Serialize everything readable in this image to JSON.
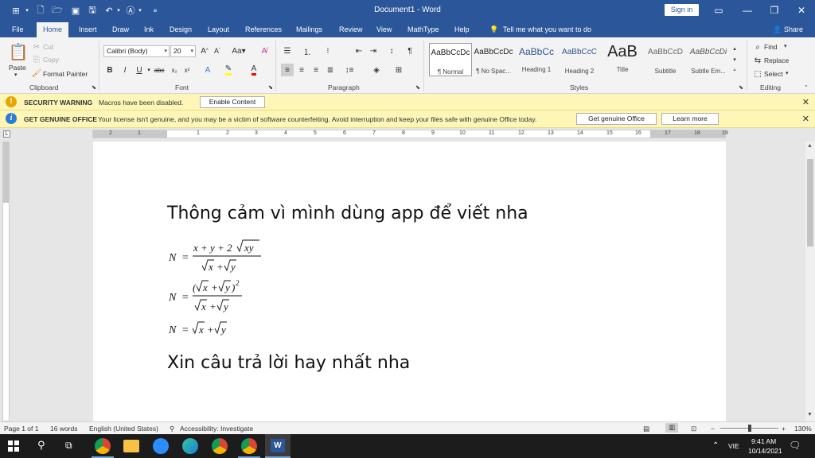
{
  "titlebar": {
    "doc_title": "Document1 - Word",
    "signin": "Sign in",
    "qat_icons": [
      "word-logo-icon",
      "new-doc-icon",
      "open-icon",
      "form-icon",
      "save-icon",
      "undo-icon",
      "ink-icon",
      "customize-icon"
    ]
  },
  "tabs": [
    "File",
    "Home",
    "Insert",
    "Draw",
    "Ink",
    "Design",
    "Layout",
    "References",
    "Mailings",
    "Review",
    "View",
    "MathType",
    "Help"
  ],
  "tell_me": "Tell me what you want to do",
  "share": "Share",
  "ribbon": {
    "clipboard": {
      "paste": "Paste",
      "cut": "Cut",
      "copy": "Copy",
      "format_painter": "Format Painter",
      "label": "Clipboard"
    },
    "font": {
      "name": "Calibri (Body)",
      "size": "20",
      "label": "Font"
    },
    "paragraph": {
      "label": "Paragraph"
    },
    "styles": {
      "label": "Styles",
      "items": [
        {
          "preview": "AaBbCcDc",
          "name": "¶ Normal"
        },
        {
          "preview": "AaBbCcDc",
          "name": "¶ No Spac..."
        },
        {
          "preview": "AaBbCc",
          "name": "Heading 1"
        },
        {
          "preview": "AaBbCcC",
          "name": "Heading 2"
        },
        {
          "preview": "AaB",
          "name": "Title"
        },
        {
          "preview": "AaBbCcD",
          "name": "Subtitle"
        },
        {
          "preview": "AaBbCcDi",
          "name": "Subtle Em..."
        }
      ]
    },
    "editing": {
      "find": "Find",
      "replace": "Replace",
      "select": "Select",
      "label": "Editing"
    }
  },
  "security_bar": {
    "head": "SECURITY WARNING",
    "message": "Macros have been disabled.",
    "button": "Enable Content"
  },
  "genuine_bar": {
    "head": "GET GENUINE OFFICE",
    "message": "Your license isn't genuine, and you may be a victim of software counterfeiting. Avoid interruption and keep your files safe with genuine Office today.",
    "button1": "Get genuine Office",
    "button2": "Learn more"
  },
  "ruler_numbers": [
    "2",
    "1",
    "1",
    "2",
    "3",
    "4",
    "5",
    "6",
    "7",
    "8",
    "9",
    "10",
    "11",
    "12",
    "13",
    "14",
    "15",
    "16",
    "17",
    "18",
    "19"
  ],
  "document": {
    "line1": "Thông cảm vì mình dùng app để viết nha",
    "line2": "Xin câu trả lời hay nhất nha",
    "equations": [
      {
        "lhs": "N =",
        "numerator": "x + y + 2√xy",
        "denominator": "√x + √y"
      },
      {
        "lhs": "N =",
        "numerator": "(√x + √y)²",
        "denominator": "√x + √y"
      },
      {
        "lhs": "N =",
        "expr": "√x + √y"
      }
    ]
  },
  "status": {
    "page": "Page 1 of 1",
    "words": "16 words",
    "language": "English (United States)",
    "accessibility": "Accessibility: Investigate",
    "zoom": "130%"
  },
  "taskbar": {
    "lang": "VIE",
    "time": "9:41 AM",
    "date": "10/14/2021"
  },
  "colors": {
    "word_blue": "#2b579a",
    "msg_yellow": "#fdf6b7",
    "warn": "#e8a400",
    "info": "#2b7cd3"
  }
}
